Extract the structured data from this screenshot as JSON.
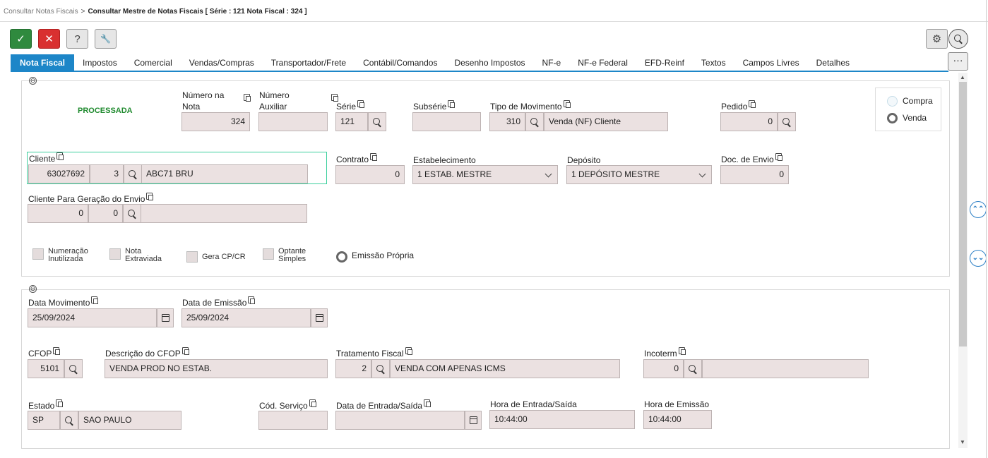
{
  "breadcrumb": {
    "parent": "Consultar Notas Fiscais",
    "separator": ">",
    "current": "Consultar Mestre de Notas Fiscais [ Série : 121 Nota Fiscal : 324 ]"
  },
  "toolbar": {
    "confirm": "✓",
    "cancel": "✕",
    "help": "?",
    "tools": "🔧",
    "settings": "⚙"
  },
  "tabs": [
    "Nota Fiscal",
    "Impostos",
    "Comercial",
    "Vendas/Compras",
    "Transportador/Frete",
    "Contábil/Comandos",
    "Desenho Impostos",
    "NF-e",
    "NF-e Federal",
    "EFD-Reinf",
    "Textos",
    "Campos Livres",
    "Detalhes"
  ],
  "more_label": "···",
  "collapse_symbol": "⊖",
  "section1": {
    "status": "PROCESSADA",
    "numero_nota_label": "Número na Nota",
    "numero_nota": "324",
    "numero_aux_label": "Número Auxiliar",
    "numero_aux": "",
    "serie_label": "Série",
    "serie": "121",
    "subserie_label": "Subsérie",
    "subserie": "",
    "tipo_mov_label": "Tipo de Movimento",
    "tipo_mov_code": "310",
    "tipo_mov_desc": "Venda (NF) Cliente",
    "pedido_label": "Pedido",
    "pedido": "0",
    "radio_compra": "Compra",
    "radio_venda": "Venda",
    "cliente_label": "Cliente",
    "cliente_code": "63027692",
    "cliente_num": "3",
    "cliente_name": "ABC71 BRU",
    "contrato_label": "Contrato",
    "contrato": "0",
    "estab_label": "Estabelecimento",
    "estab": "1 ESTAB. MESTRE",
    "deposito_label": "Depósito",
    "deposito": "1 DEPÓSITO MESTRE",
    "docenvio_label": "Doc. de Envio",
    "docenvio": "0",
    "cli_envio_label": "Cliente Para Geração do Envio",
    "cli_envio_a": "0",
    "cli_envio_b": "0",
    "cli_envio_c": "",
    "chk_numeracao": [
      "Numeração",
      "Inutilizada"
    ],
    "chk_nota": [
      "Nota",
      "Extraviada"
    ],
    "chk_gera": "Gera CP/CR",
    "chk_optante": [
      "Optante",
      "Simples"
    ],
    "emissao_propria": "Emissão Própria"
  },
  "section2": {
    "data_mov_label": "Data Movimento",
    "data_mov": "25/09/2024",
    "data_emi_label": "Data de Emissão",
    "data_emi": "25/09/2024",
    "cfop_label": "CFOP",
    "cfop": "5101",
    "desc_cfop_label": "Descrição do CFOP",
    "desc_cfop": "VENDA PROD NO ESTAB.",
    "trat_label": "Tratamento Fiscal",
    "trat_code": "2",
    "trat_desc": "VENDA COM APENAS ICMS",
    "incoterm_label": "Incoterm",
    "incoterm_code": "0",
    "incoterm_desc": "",
    "estado_label": "Estado",
    "estado_code": "SP",
    "estado_name": "SAO PAULO",
    "cod_serv_label": "Cód. Serviço",
    "cod_serv": "",
    "data_es_label": "Data de Entrada/Saída",
    "data_es": "",
    "hora_es_label": "Hora de Entrada/Saída",
    "hora_es": "10:44:00",
    "hora_emi_label": "Hora de Emissão",
    "hora_emi": "10:44:00"
  },
  "scroll": {
    "up": "⌃⌃",
    "down": "⌄⌄"
  }
}
